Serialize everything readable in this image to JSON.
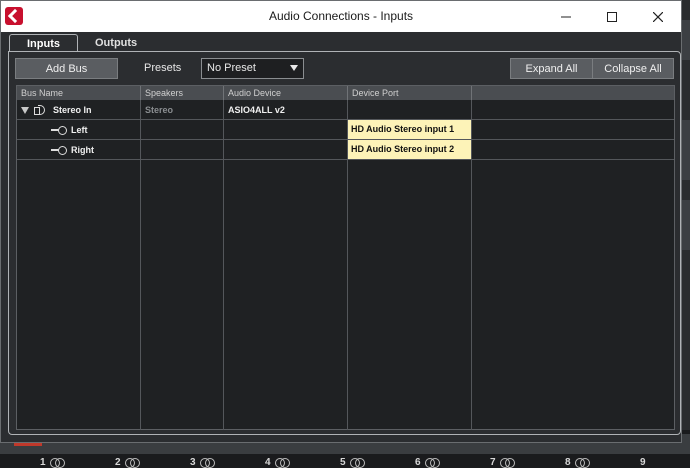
{
  "window": {
    "title": "Audio Connections - Inputs"
  },
  "tabs": [
    {
      "label": "Inputs",
      "active": true
    },
    {
      "label": "Outputs",
      "active": false
    }
  ],
  "toolbar": {
    "add_bus_label": "Add Bus",
    "presets_label": "Presets",
    "preset_value": "No Preset",
    "expand_all_label": "Expand All",
    "collapse_all_label": "Collapse All"
  },
  "table": {
    "columns": [
      "Bus Name",
      "Speakers",
      "Audio Device",
      "Device Port"
    ],
    "rows": [
      {
        "bus_name": "Stereo In",
        "speakers": "Stereo",
        "audio_device": "ASIO4ALL v2",
        "device_port": "",
        "icon": "speaker-icon",
        "expanded": true
      },
      {
        "bus_name": "Left",
        "speakers": "",
        "audio_device": "",
        "device_port": "HD Audio Stereo input 1",
        "icon": "plug-icon"
      },
      {
        "bus_name": "Right",
        "speakers": "",
        "audio_device": "",
        "device_port": "HD Audio Stereo input 2",
        "icon": "plug-icon"
      }
    ]
  },
  "background_mixer": {
    "channels": [
      "1",
      "2",
      "3",
      "4",
      "5",
      "6",
      "7",
      "8",
      "9"
    ]
  }
}
